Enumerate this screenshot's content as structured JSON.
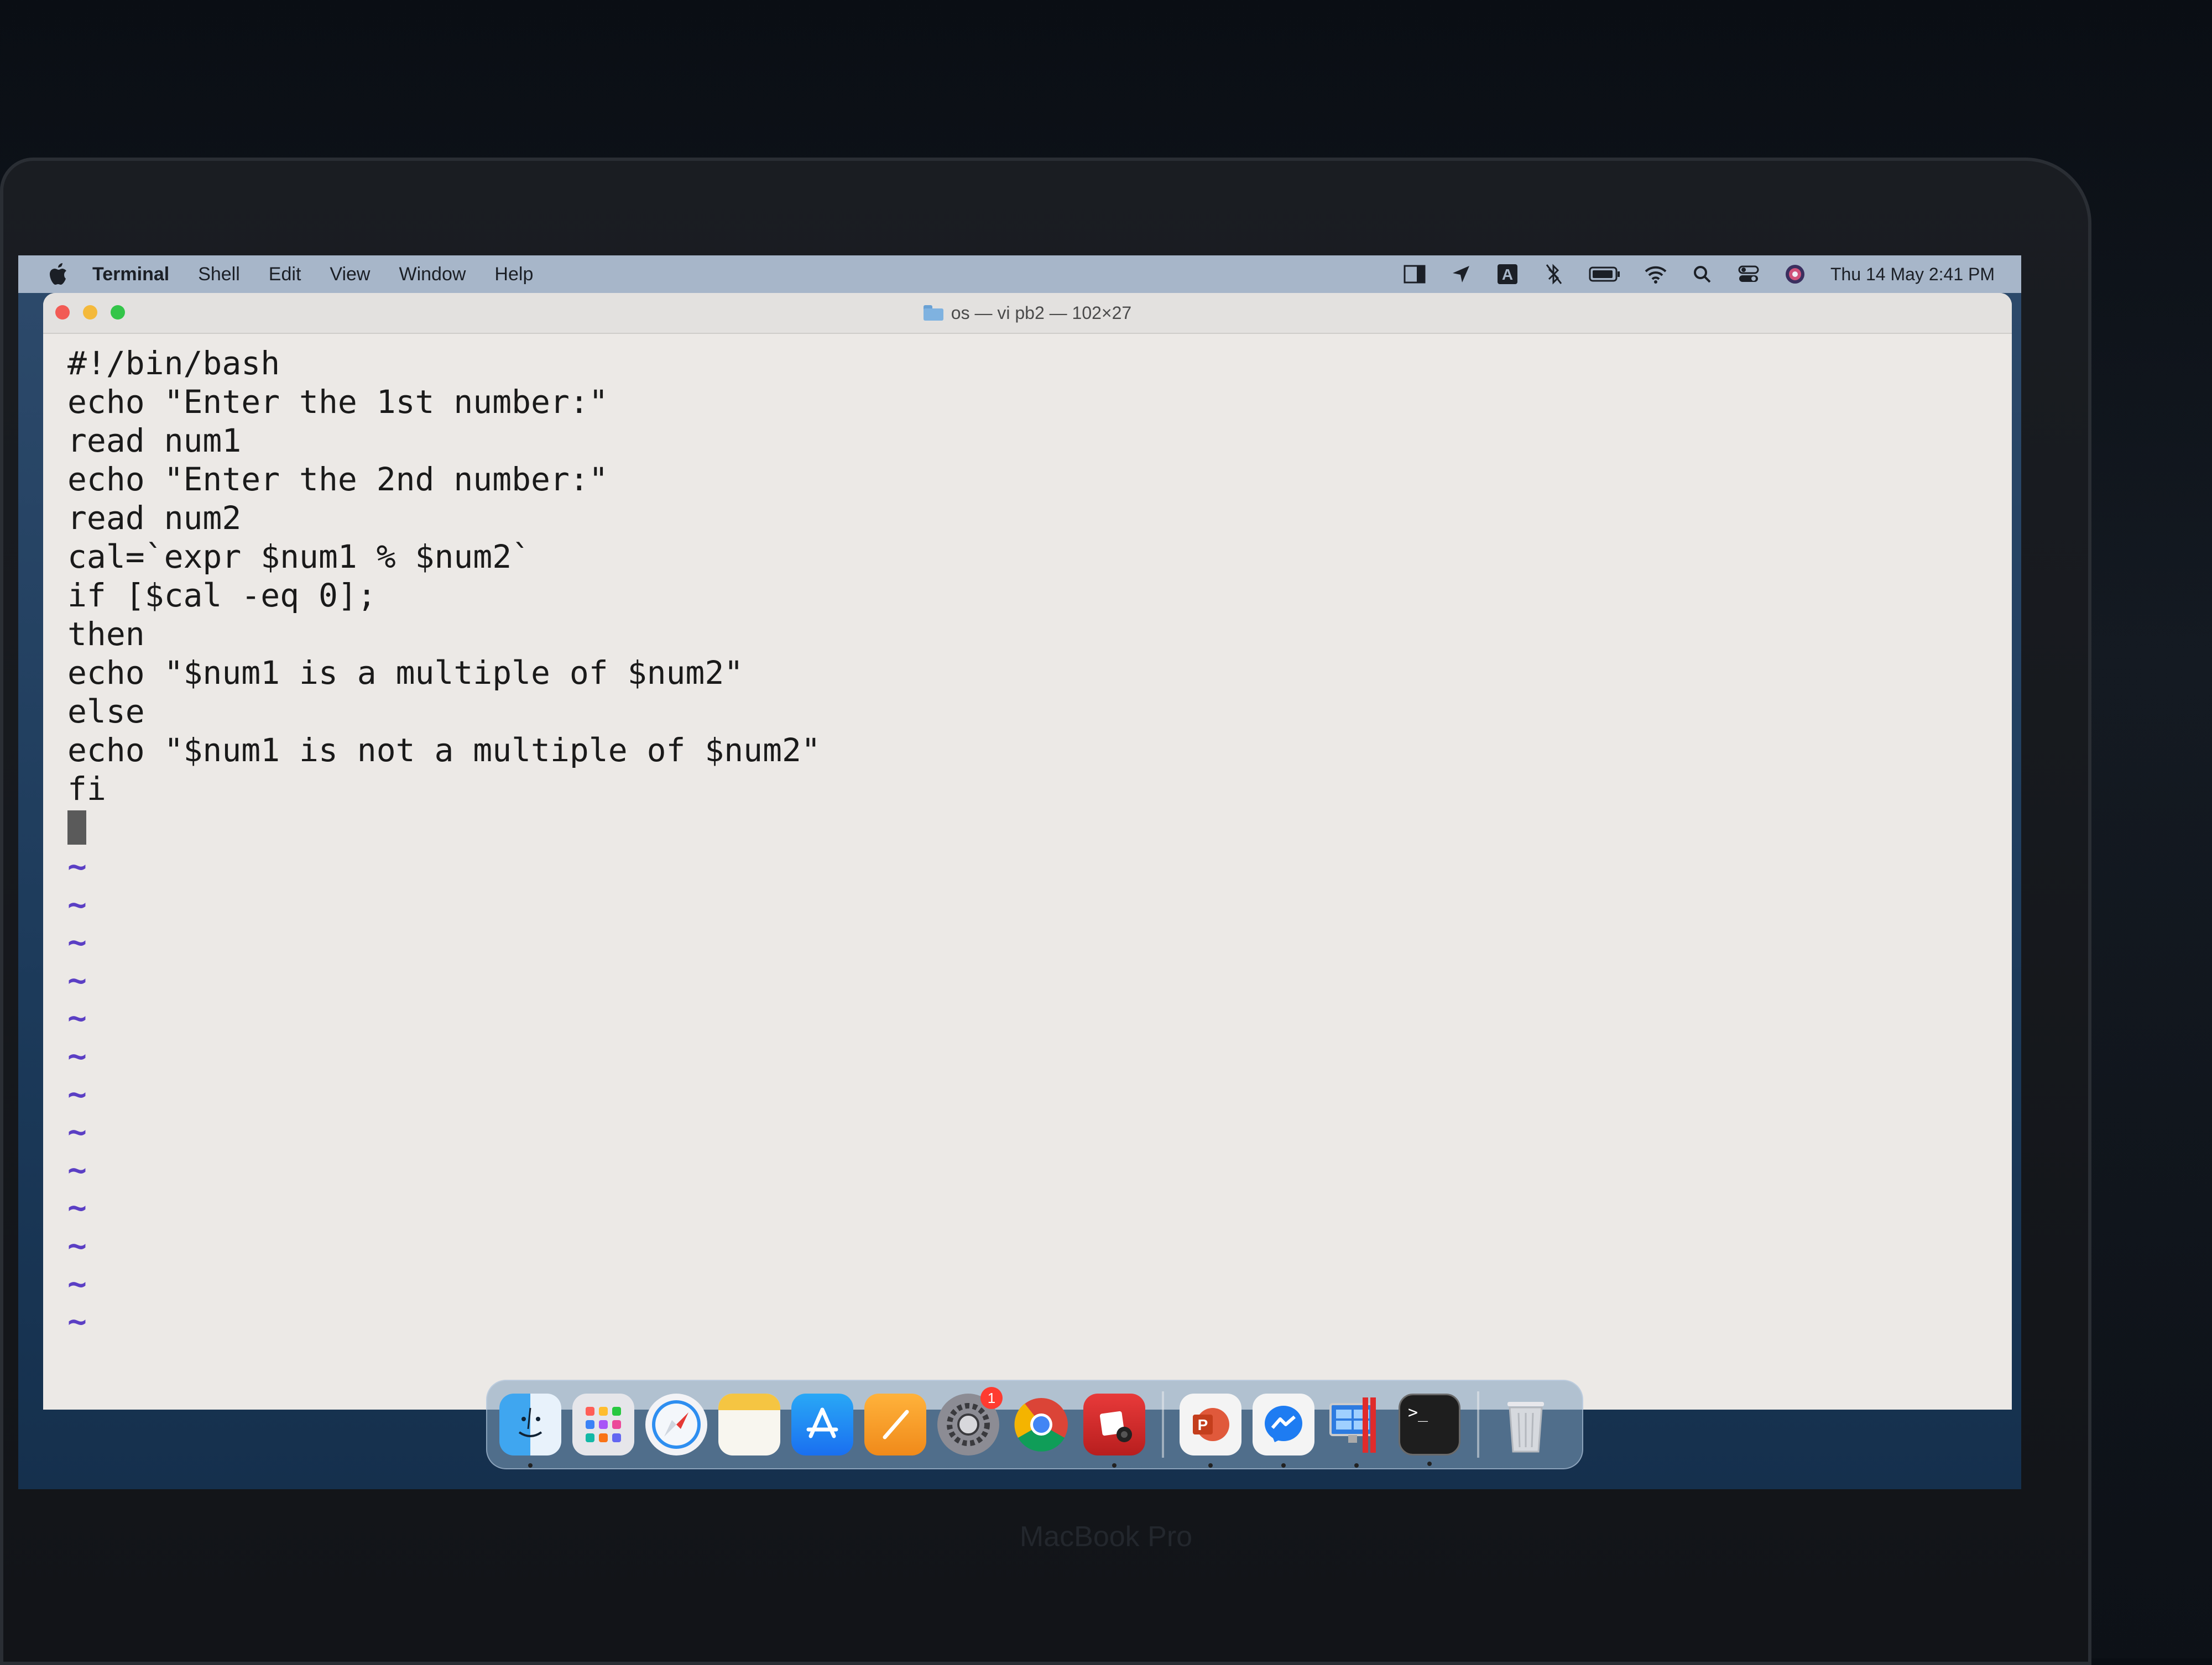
{
  "menubar": {
    "app_name": "Terminal",
    "items": [
      "Shell",
      "Edit",
      "View",
      "Window",
      "Help"
    ],
    "clock": "Thu 14 May  2:41 PM"
  },
  "window": {
    "title": "os — vi pb2 — 102×27"
  },
  "editor": {
    "lines": [
      "#!/bin/bash",
      "echo \"Enter the 1st number:\"",
      "read num1",
      "echo \"Enter the 2nd number:\"",
      "read num2",
      "cal=`expr $num1 % $num2`",
      "if [$cal -eq 0];",
      "then",
      "echo \"$num1 is a multiple of $num2\"",
      "else",
      "echo \"$num1 is not a multiple of $num2\"",
      "fi"
    ],
    "tilde": "~"
  },
  "dock": {
    "system_preferences_badge": "1",
    "terminal_prompt_glyph": ">_",
    "powerpoint_glyph": "P"
  },
  "device": {
    "label": "MacBook Pro"
  }
}
